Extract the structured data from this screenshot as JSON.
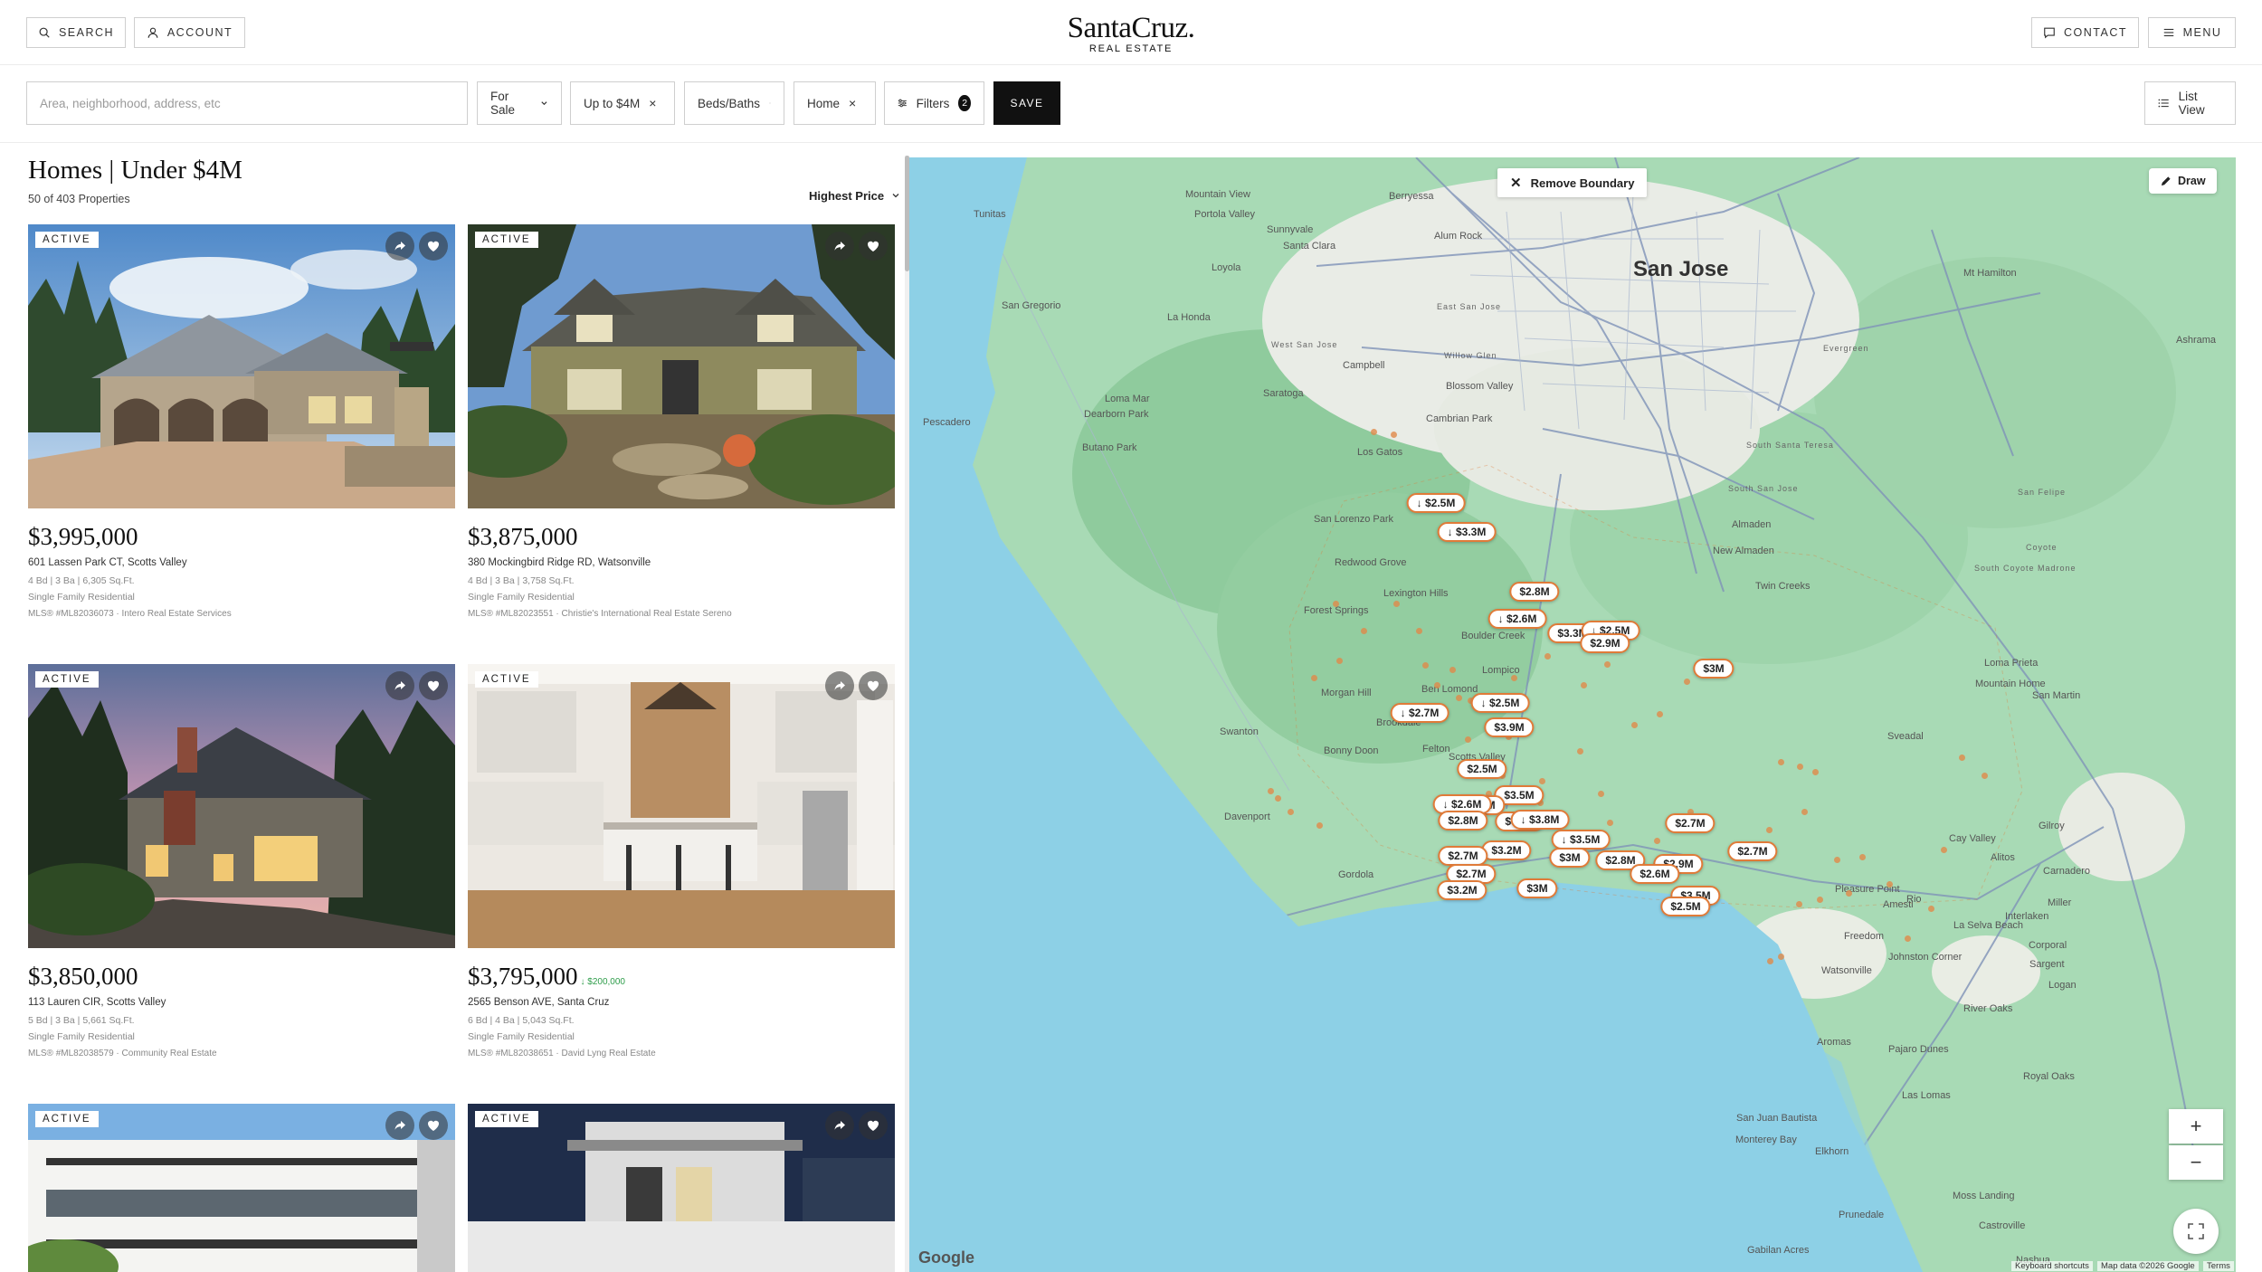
{
  "header": {
    "search_label": "SEARCH",
    "account_label": "ACCOUNT",
    "logo_name": "SantaCruz.",
    "logo_sub": "REAL ESTATE",
    "contact_label": "CONTACT",
    "menu_label": "MENU"
  },
  "filters": {
    "search_placeholder": "Area, neighborhood, address, etc",
    "status": "For Sale",
    "price": "Up to $4M",
    "beds_baths": "Beds/Baths",
    "home_type": "Home",
    "filters_label": "Filters",
    "filters_count": "2",
    "save_label": "SAVE",
    "list_view_label": "List View"
  },
  "listing": {
    "title": "Homes | Under $4M",
    "count": "50 of 403 Properties",
    "sort": "Highest Price"
  },
  "cards": [
    {
      "status": "ACTIVE",
      "price": "$3,995,000",
      "price_change": "",
      "address": "601 Lassen Park CT, Scotts Valley",
      "specs": "4 Bd | 3 Ba | 6,305 Sq.Ft.",
      "type": "Single Family Residential",
      "mls": "MLS® #ML82036073 · Intero Real Estate Services"
    },
    {
      "status": "ACTIVE",
      "price": "$3,875,000",
      "price_change": "",
      "address": "380 Mockingbird Ridge RD, Watsonville",
      "specs": "4 Bd | 3 Ba | 3,758 Sq.Ft.",
      "type": "Single Family Residential",
      "mls": "MLS® #ML82023551 · Christie's International Real Estate Sereno"
    },
    {
      "status": "ACTIVE",
      "price": "$3,850,000",
      "price_change": "",
      "address": "113 Lauren CIR, Scotts Valley",
      "specs": "5 Bd | 3 Ba | 5,661 Sq.Ft.",
      "type": "Single Family Residential",
      "mls": "MLS® #ML82038579 · Community Real Estate"
    },
    {
      "status": "ACTIVE",
      "price": "$3,795,000",
      "price_change": "↓ $200,000",
      "address": "2565 Benson AVE, Santa Cruz",
      "specs": "6 Bd | 4 Ba | 5,043 Sq.Ft.",
      "type": "Single Family Residential",
      "mls": "MLS® #ML82038651 · David Lyng Real Estate"
    },
    {
      "status": "ACTIVE"
    },
    {
      "status": "ACTIVE"
    }
  ],
  "map": {
    "remove_boundary": "Remove Boundary",
    "draw": "Draw",
    "zoom_in": "+",
    "zoom_out": "−",
    "google": "Google",
    "attribution": [
      "Keyboard shortcuts",
      "Map data ©2026 Google",
      "Terms"
    ],
    "places": [
      "San Jose",
      "Tunitas",
      "Portola Valley",
      "Mountain View",
      "Sunnyvale",
      "Santa Clara",
      "Berryessa",
      "Alum Rock",
      "Loyola",
      "San Gregorio",
      "La Honda",
      "Mt Hamilton",
      "Ashrama",
      "East San Jose",
      "West San Jose",
      "Willow Glen",
      "Evergreen",
      "Campbell",
      "Saratoga",
      "Blossom Valley",
      "Loma Mar",
      "Dearborn Park",
      "Pescadero",
      "Cambrian Park",
      "Butano Park",
      "Los Gatos",
      "South Santa Teresa",
      "South San Jose",
      "San Felipe",
      "San Lorenzo Park",
      "Almaden",
      "New Almaden",
      "Redwood Grove",
      "Lexington Hills",
      "Coyote",
      "South Coyote Madrone",
      "Twin Creeks",
      "Forest Springs",
      "Boulder Creek",
      "Loma Prieta",
      "Morgan Hill",
      "Mountain Home",
      "Brookdale",
      "Lompico",
      "Ben Lomond",
      "San Martin",
      "Swanton",
      "Sveadal",
      "Bonny Doon",
      "Felton",
      "Scotts Valley",
      "Gilroy",
      "Davenport",
      "Carnadero",
      "Gordola",
      "Amesti",
      "Interlaken",
      "Miller",
      "Freedom",
      "Corporal",
      "Sargent",
      "Johnston Corner",
      "Watsonville",
      "Logan",
      "River Oaks",
      "Aromas",
      "Pajaro Dunes",
      "Las Lomas",
      "Royal Oaks",
      "San Juan Bautista",
      "Elkhorn",
      "Moss Landing",
      "Prunedale",
      "Castroville",
      "Gabilan Acres",
      "Nashua",
      "Monterey Bay",
      "Alitos",
      "Cay Valley",
      "La Selva Beach",
      "Rio",
      "Pleasure Point"
    ],
    "markers": [
      "↓ $2.5M",
      "↓ $3.3M",
      "$2.8M",
      "↓ $2.6M",
      "$3.3M",
      "↓ $2.5M",
      "$2.9M",
      "$3M",
      "↓ $2.7M",
      "↓ $2.5M",
      "$3.9M",
      "$3.5M",
      "$3.5M",
      "$2.5M",
      "↓ $2.6M",
      "$2.8M",
      "$3.5M",
      "↓ $3.8M",
      "↓ $3.5M",
      "$2.7M",
      "$3.2M",
      "$3M",
      "$2.8M",
      "$2.9M",
      "$2.7M",
      "$2.7M",
      "$2.6M",
      "$3.5M",
      "$2.7M",
      "$3.2M",
      "$3M",
      "$2.5M"
    ]
  },
  "colors": {
    "marker_border": "#e07b39",
    "water": "#8dd0e6",
    "land": "#a8dab5",
    "price_drop": "#2e9d4a"
  }
}
